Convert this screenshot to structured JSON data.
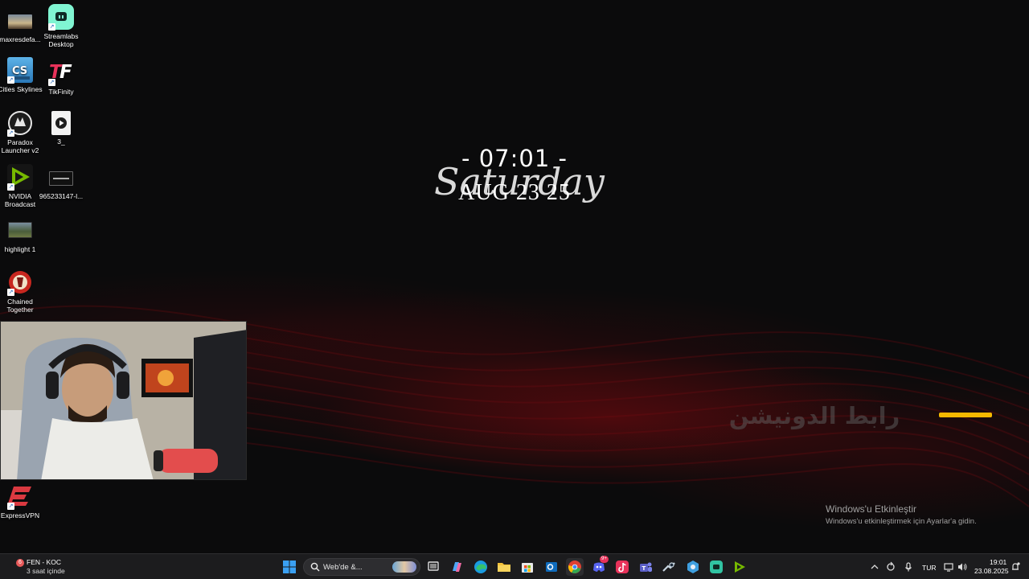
{
  "desktop": {
    "icons": [
      {
        "label": "maxresdefa...",
        "icon": "image-file-icon"
      },
      {
        "label": "Streamlabs Desktop",
        "icon": "streamlabs-icon"
      },
      {
        "label": "Cities Skylines",
        "icon": "cities-skylines-icon"
      },
      {
        "label": "TikFinity",
        "icon": "tikfinity-icon"
      },
      {
        "label": "Paradox Launcher v2",
        "icon": "paradox-launcher-icon"
      },
      {
        "label": "3_",
        "icon": "video-file-icon"
      },
      {
        "label": "NVIDIA Broadcast",
        "icon": "nvidia-broadcast-icon"
      },
      {
        "label": "965233147-l...",
        "icon": "video-thumbnail-icon"
      },
      {
        "label": "highlight 1",
        "icon": "video-thumbnail-icon"
      },
      {
        "label": "Chained Together",
        "icon": "chained-together-icon"
      },
      {
        "label": "ExpressVPN",
        "icon": "expressvpn-icon"
      }
    ]
  },
  "clock_widget": {
    "time": "- 07:01 -",
    "day": "Saturday",
    "date": "AUG 23 25"
  },
  "overlay": {
    "donation_text": "رابط الدونيشن",
    "accent_color": "#f5b800"
  },
  "activation": {
    "title": "Windows'u Etkinleştir",
    "subtitle": "Windows'u etkinleştirmek için Ayarlar'a gidin."
  },
  "taskbar": {
    "weather": {
      "badge": "6",
      "line1": "FEN - KOC",
      "line2": "3 saat içinde"
    },
    "search_placeholder": "Web'de &...",
    "apps": [
      "start-icon",
      "task-view-icon",
      "copilot-icon",
      "edge-icon",
      "file-explorer-icon",
      "microsoft-store-icon",
      "outlook-icon",
      "chrome-icon",
      "discord-icon",
      "tiktok-icon",
      "teams-icon",
      "steam-icon",
      "settings-app-icon",
      "streamlabs-icon",
      "nvidia-app-icon"
    ],
    "discord_badge": "9+",
    "tray": {
      "language": "TUR",
      "time": "19:01",
      "date": "23.08.2025"
    }
  }
}
